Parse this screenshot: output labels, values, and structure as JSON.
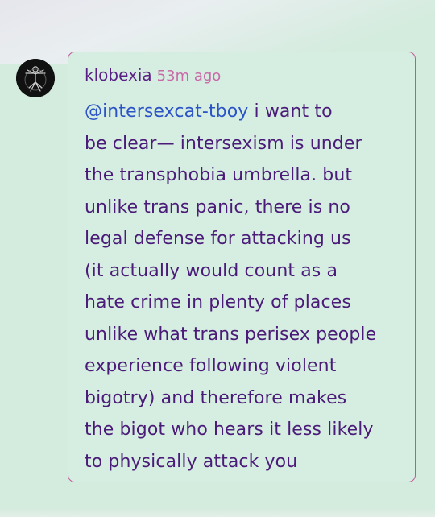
{
  "comment": {
    "author": "klobexia",
    "time": "53m ago",
    "mention": "@intersexcat-tboy",
    "first_line_rest": " i want to",
    "lines": [
      "be clear— intersexism is under",
      "the transphobia umbrella. but",
      "unlike trans panic, there is no",
      "legal defense for attacking us",
      "(it actually would count as a",
      "hate crime in plenty of places",
      "unlike what trans perisex people",
      "experience following violent",
      "bigotry) and therefore makes",
      "the bigot who hears it less likely",
      "to physically attack you"
    ]
  },
  "colors": {
    "background": "#d3ecdd",
    "card_border": "#c2569a",
    "author": "#5a1f86",
    "timestamp": "#c86aa8",
    "mention": "#2b53c7",
    "body_text": "#4a1b78"
  },
  "icons": {
    "avatar": "vitruvian-figure-avatar"
  }
}
